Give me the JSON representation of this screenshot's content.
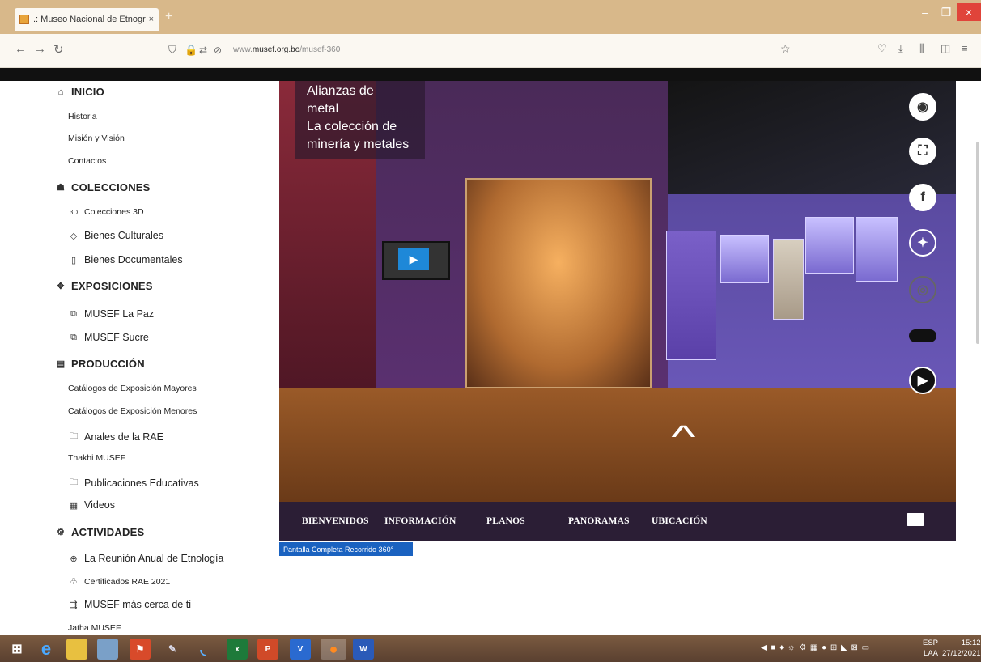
{
  "browser": {
    "tab_title": ".: Museo Nacional de Etnograf",
    "tab_close": "×",
    "new_tab": "+",
    "url_prefix": "www.",
    "url_domain": "musef.org.bo",
    "url_path": "/musef-360",
    "win_min": "–",
    "win_max": "❐",
    "win_close": "×"
  },
  "sidebar": {
    "inicio": "INICIO",
    "historia": "Historia",
    "mision": "Misión y Visión",
    "contactos": "Contactos",
    "colecciones": "COLECCIONES",
    "colecciones_3d": "Colecciones 3D",
    "bienes_culturales": "Bienes Culturales",
    "bienes_documentales": "Bienes Documentales",
    "exposiciones": "EXPOSICIONES",
    "musef_lapaz": "MUSEF La Paz",
    "musef_sucre": "MUSEF Sucre",
    "produccion": "PRODUCCIÓN",
    "catalogos_mayores": "Catálogos de Exposición Mayores",
    "catalogos_menores": "Catálogos de Exposición Menores",
    "anales": "Anales de la RAE",
    "thakhi": "Thakhi MUSEF",
    "publicaciones": "Publicaciones Educativas",
    "videos": "Videos",
    "actividades": "ACTIVIDADES",
    "reunion": "La Reunión Anual de Etnología",
    "certificados": "Certificados RAE 2021",
    "cerca": "MUSEF más cerca de ti",
    "jatha": "Jatha MUSEF"
  },
  "viewer": {
    "title_line1": "Alianzas de",
    "title_line2": "metal",
    "title_line3": "La colección de",
    "title_line4": "minería y metales",
    "nav_bienvenidos": "BIENVENIDOS",
    "nav_informacion": "INFORMACIÓN",
    "nav_planos": "PLANOS",
    "nav_panoramas": "PANORAMAS",
    "nav_ubicacion": "UBICACIÓN",
    "fullscreen_label": "Pantalla Completa Recorrido 360°"
  },
  "taskbar": {
    "lang1": "ESP",
    "lang2": "LAA",
    "time": "15:12",
    "date": "27/12/2021"
  },
  "colors": {
    "titlebar": "#d8b88a",
    "accent_blue": "#1a62c0",
    "viewer_nav": "#2b1e35"
  }
}
